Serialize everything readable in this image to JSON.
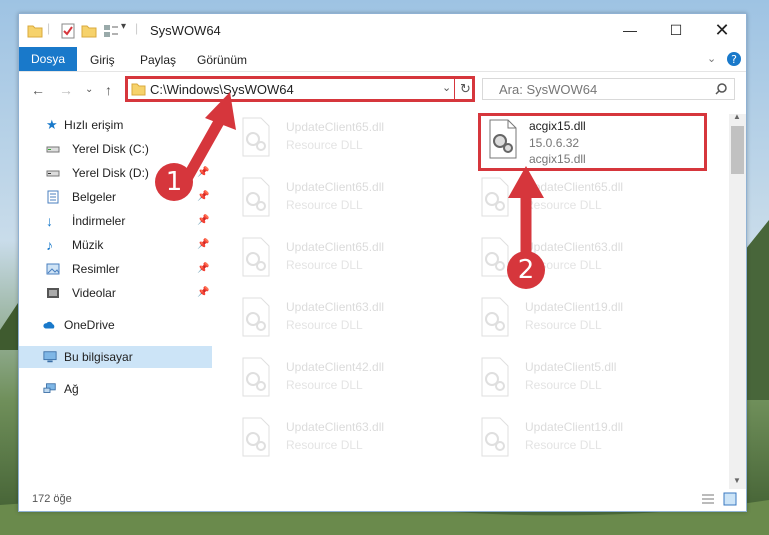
{
  "window": {
    "title": "SysWOW64"
  },
  "ribbon": {
    "tabs": [
      "Dosya",
      "Giriş",
      "Paylaş",
      "Görünüm"
    ]
  },
  "address": {
    "path": "C:\\Windows\\SysWOW64"
  },
  "search": {
    "placeholder": "Ara: SysWOW64"
  },
  "sidebar": {
    "quick_access": "Hızlı erişim",
    "items": [
      {
        "label": "Yerel Disk (C:)",
        "icon": "drive-icon",
        "pinned": true
      },
      {
        "label": "Yerel Disk (D:)",
        "icon": "drive-icon",
        "pinned": true
      },
      {
        "label": "Belgeler",
        "icon": "documents-icon",
        "pinned": true
      },
      {
        "label": "İndirmeler",
        "icon": "downloads-icon",
        "pinned": true
      },
      {
        "label": "Müzik",
        "icon": "music-icon",
        "pinned": true
      },
      {
        "label": "Resimler",
        "icon": "pictures-icon",
        "pinned": true
      },
      {
        "label": "Videolar",
        "icon": "videos-icon",
        "pinned": true
      }
    ],
    "onedrive": "OneDrive",
    "this_pc": "Bu bilgisayar",
    "network": "Ağ"
  },
  "files": {
    "left": [
      {
        "name": "UpdateClient65.dll",
        "type": "Resource DLL"
      },
      {
        "name": "UpdateClient65.dll",
        "type": "Resource DLL"
      },
      {
        "name": "UpdateClient65.dll",
        "type": "Resource DLL"
      },
      {
        "name": "UpdateClient63.dll",
        "type": "Resource DLL"
      },
      {
        "name": "UpdateClient42.dll",
        "type": "Resource DLL"
      },
      {
        "name": "UpdateClient63.dll",
        "type": "Resource DLL"
      }
    ],
    "right": [
      {
        "name": "acgix15.dll",
        "version": "15.0.6.32",
        "desc": "acgix15.dll",
        "highlighted": true
      },
      {
        "name": "UpdateClient65.dll",
        "type": "Resource DLL"
      },
      {
        "name": "UpdateClient63.dll",
        "type": "Resource DLL"
      },
      {
        "name": "UpdateClient19.dll",
        "type": "Resource DLL"
      },
      {
        "name": "UpdateClient5.dll",
        "type": "Resource DLL"
      },
      {
        "name": "UpdateClient19.dll",
        "type": "Resource DLL"
      }
    ]
  },
  "status": {
    "count": "172 öğe"
  },
  "annotations": {
    "step1": "1",
    "step2": "2"
  },
  "colors": {
    "accent": "#1979ca",
    "highlight": "#d6363c",
    "selected": "#cce4f7"
  }
}
